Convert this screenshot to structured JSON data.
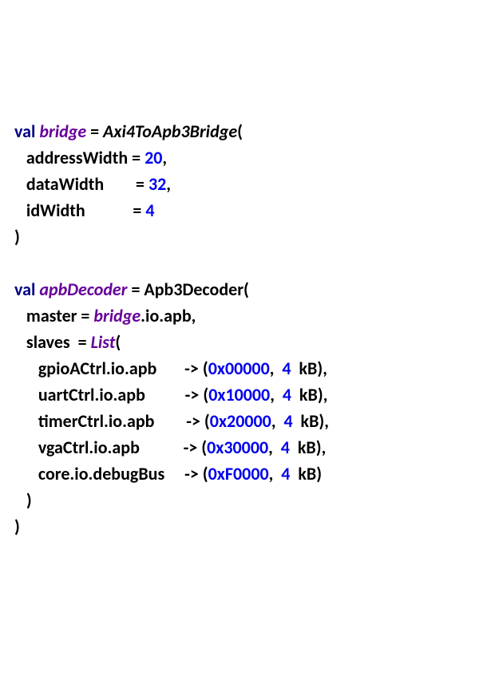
{
  "block1": {
    "l1": {
      "kw": "val",
      "name": "bridge",
      "eq": " = ",
      "type": "Axi4ToApb3Bridge",
      "open": "("
    },
    "l2": {
      "pad": "   ",
      "label": "addressWidth",
      "eq": " = ",
      "val": "20",
      "comma": ","
    },
    "l3": {
      "pad": "   ",
      "label": "dataWidth",
      "gap": "       ",
      "eq": " = ",
      "val": "32",
      "comma": ","
    },
    "l4": {
      "pad": "   ",
      "label": "idWidth",
      "gap": "           ",
      "eq": " = ",
      "val": "4"
    },
    "l5": {
      "close": ")"
    }
  },
  "blank": " ",
  "block2": {
    "l1": {
      "kw": "val",
      "name": "apbDecoder",
      "eq": " = ",
      "type": "Apb3Decoder("
    },
    "l2": {
      "pad": "   ",
      "label": "master = ",
      "ref": "bridge",
      "after": ".io.apb,"
    },
    "l3": {
      "pad": "   ",
      "label": "slaves  = ",
      "type": "List",
      "open": "("
    },
    "rows": [
      {
        "pad": "      ",
        "lhs": "gpioACtrl.io.apb",
        "gap": "       ",
        "arrow": "-> (",
        "addr": "0x00000",
        "sep": ",  ",
        "size": "4",
        "unit": "  kB)",
        "comma": ","
      },
      {
        "pad": "      ",
        "lhs": "uartCtrl.io.apb",
        "gap": "          ",
        "arrow": "-> (",
        "addr": "0x10000",
        "sep": ",  ",
        "size": "4",
        "unit": "  kB)",
        "comma": ","
      },
      {
        "pad": "      ",
        "lhs": "timerCtrl.io.apb",
        "gap": "        ",
        "arrow": "-> (",
        "addr": "0x20000",
        "sep": ",  ",
        "size": "4",
        "unit": "  kB)",
        "comma": ","
      },
      {
        "pad": "      ",
        "lhs": "vgaCtrl.io.apb",
        "gap": "           ",
        "arrow": "-> (",
        "addr": "0x30000",
        "sep": ",  ",
        "size": "4",
        "unit": "  kB)",
        "comma": ","
      },
      {
        "pad": "      ",
        "lhs": "core.io.debugBus",
        "gap": "     ",
        "arrow": "-> (",
        "addr": "0xF0000",
        "sep": ",  ",
        "size": "4",
        "unit": "  kB)",
        "comma": ""
      }
    ],
    "l9": {
      "pad": "   ",
      "close": ")"
    },
    "l10": {
      "close": ")"
    }
  }
}
